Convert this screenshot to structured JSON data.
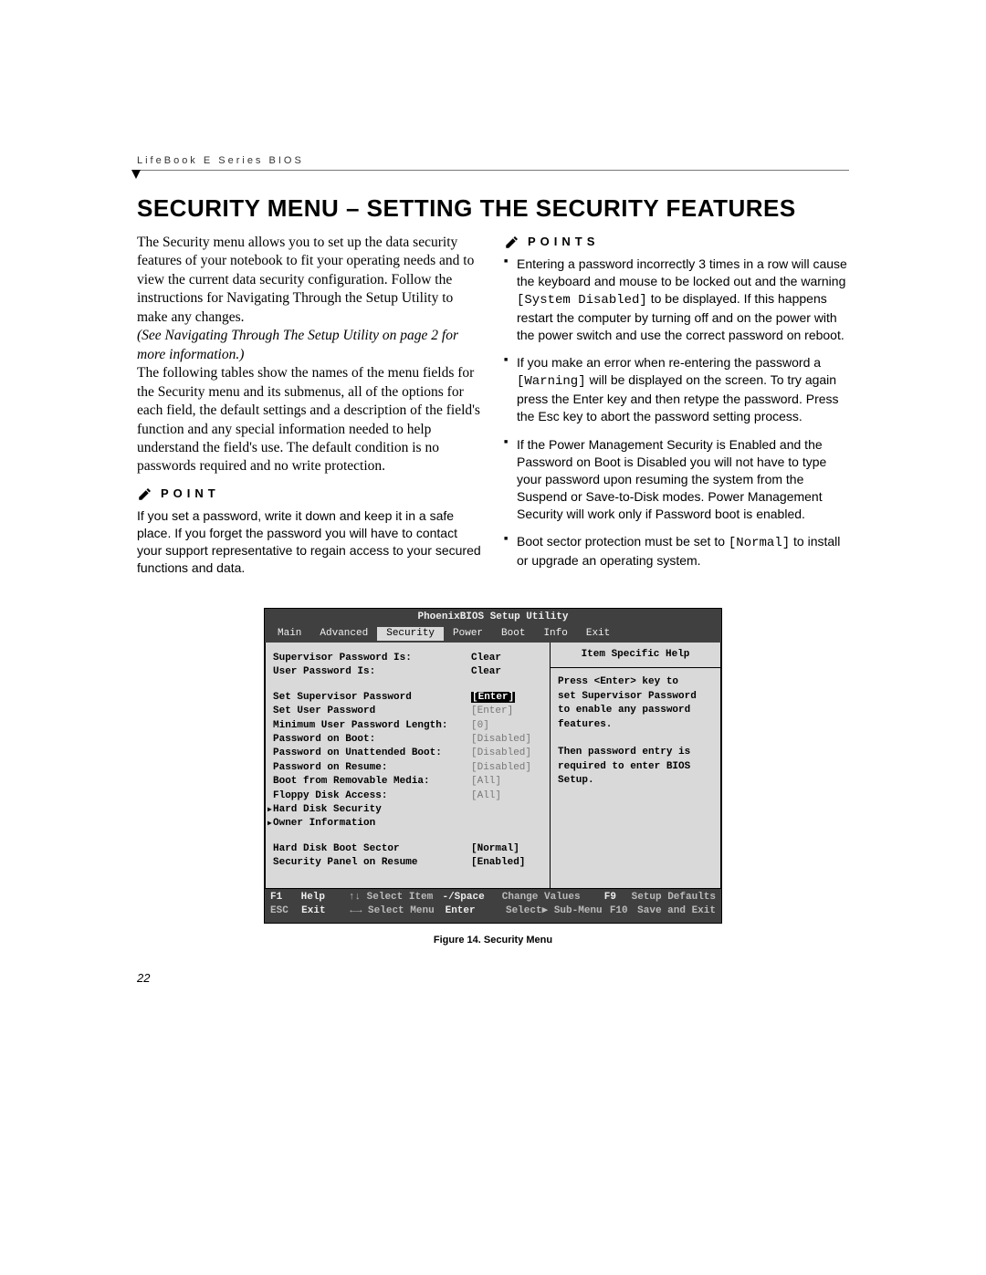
{
  "running_header": "LifeBook E Series BIOS",
  "section_title": "SECURITY MENU – SETTING THE SECURITY FEATURES",
  "left_column": {
    "intro": "The Security menu allows you to set up the data security features of your notebook to fit your operating needs and to view the current data security configuration. Follow the instructions for Navigating Through the Setup Utility to make any changes.",
    "see_ref": "(See Navigating Through The Setup Utility on page 2 for more information.)",
    "para2": "The following tables show the names of the menu fields for the Security menu and its submenus, all of the options for each field, the default settings and a description of the field's function and any special information needed to help understand the field's use. The default condition is no passwords required and no write protection.",
    "point_label": "POINT",
    "point_body": "If you set a password, write it down and keep it in a safe place. If you forget the password you will have to contact your support representative to regain access to your secured functions and data."
  },
  "right_column": {
    "points_label": "POINTS",
    "bullets": [
      {
        "pre": "Entering a password incorrectly 3 times in a row will cause the keyboard and mouse to be locked out and the warning ",
        "code": "[System Disabled]",
        "post": " to be displayed. If this happens restart the computer by turning off and on the power with the power switch and use the correct password on reboot."
      },
      {
        "pre": "If you make an error when re-entering the password a ",
        "code": "[Warning]",
        "post": " will be displayed on the screen. To try again press the Enter key and then retype the password. Press the Esc key to abort the password setting process."
      },
      {
        "pre": "If the Power Management Security is Enabled and the Password on Boot is Disabled you will not have to type your password upon resuming the system from the Suspend or Save-to-Disk modes. Power Management Security will work only if Password boot is enabled.",
        "code": "",
        "post": ""
      },
      {
        "pre": "Boot sector protection must be set to ",
        "code": "[Normal]",
        "post": " to install or upgrade an operating system."
      }
    ]
  },
  "bios": {
    "utility_title": "PhoenixBIOS Setup Utility",
    "menus": [
      "Main",
      "Advanced",
      "Security",
      "Power",
      "Boot",
      "Info",
      "Exit"
    ],
    "active_menu": "Security",
    "help_title": "Item Specific Help",
    "help_text_lines": [
      "Press <Enter> key to",
      "set Supervisor Password",
      "to enable any password",
      "features.",
      "",
      "Then password entry is",
      "required to enter BIOS",
      "Setup."
    ],
    "rows": [
      {
        "label": "Supervisor Password Is:",
        "value": "Clear",
        "style": "plain"
      },
      {
        "label": "User Password Is:",
        "value": "Clear",
        "style": "plain"
      },
      {
        "gap": true
      },
      {
        "label": "Set Supervisor Password",
        "value": "[Enter]",
        "style": "selected"
      },
      {
        "label": "Set User Password",
        "value": "[Enter]",
        "style": "dim"
      },
      {
        "label": "Minimum User Password Length:",
        "value": "[0]",
        "style": "dim"
      },
      {
        "label": "Password on Boot:",
        "value": "[Disabled]",
        "style": "dim"
      },
      {
        "label": "Password on Unattended Boot:",
        "value": "[Disabled]",
        "style": "dim"
      },
      {
        "label": "Password on Resume:",
        "value": "[Disabled]",
        "style": "dim"
      },
      {
        "label": "Boot from Removable Media:",
        "value": "[All]",
        "style": "dim"
      },
      {
        "label": "Floppy Disk Access:",
        "value": "[All]",
        "style": "dim"
      },
      {
        "label": "Hard Disk Security",
        "value": "",
        "style": "submenu"
      },
      {
        "label": "Owner Information",
        "value": "",
        "style": "submenu"
      },
      {
        "gap": true
      },
      {
        "label": "Hard Disk Boot Sector",
        "value": "[Normal]",
        "style": "plain"
      },
      {
        "label": "Security Panel on Resume",
        "value": "[Enabled]",
        "style": "plain"
      }
    ],
    "footer": {
      "line1": {
        "k1": "F1",
        "a1": "Help",
        "m1": "↑↓ Select Item",
        "m2": "-/Space",
        "m3": "Change Values",
        "k2": "F9",
        "a2": "Setup Defaults"
      },
      "line2": {
        "k1": "ESC",
        "a1": "Exit",
        "m1": "←→ Select Menu",
        "m2": "Enter",
        "m3": "Select▶ Sub-Menu",
        "k2": "F10",
        "a2": "Save and Exit"
      }
    }
  },
  "figure_caption": "Figure 14.  Security Menu",
  "page_number": "22"
}
